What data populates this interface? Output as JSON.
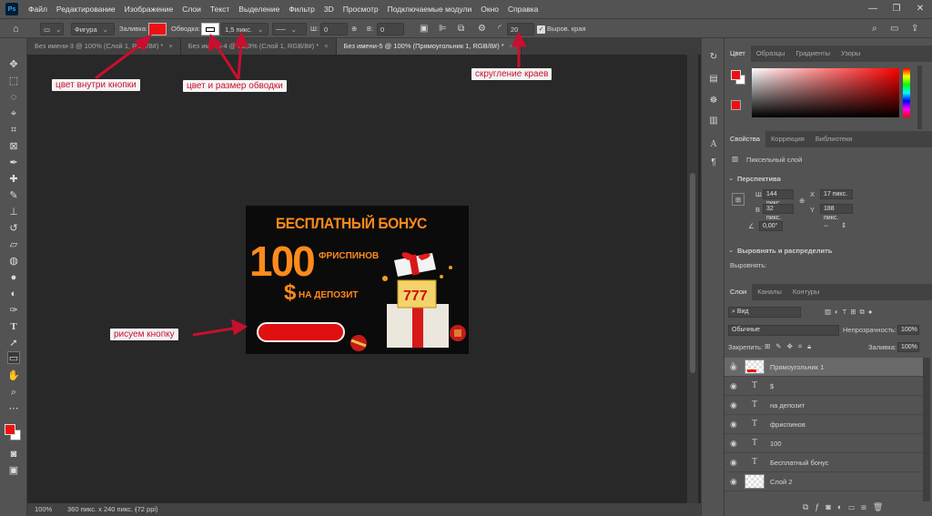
{
  "menu": {
    "logo": "Ps",
    "items": [
      "Файл",
      "Редактирование",
      "Изображение",
      "Слои",
      "Текст",
      "Выделение",
      "Фильтр",
      "3D",
      "Просмотр",
      "Подключаемые модули",
      "Окно",
      "Справка"
    ],
    "win_min": "—",
    "win_max": "❐",
    "win_close": "✕"
  },
  "options": {
    "mode": "Фигура",
    "fill_label": "Заливка:",
    "stroke_label": "Обводка:",
    "stroke_size": "1,5 пикс.",
    "w_label": "Ш:",
    "w_value": "0 пикс.",
    "h_label": "В:",
    "h_value": "0 пикс.",
    "radius": "20 пикс.",
    "align_edges": "Выров. края",
    "fill_color": "#ee1111"
  },
  "tabs": [
    {
      "label": "Без имени-3 @ 100% (Слой 1, RGB/8#) *"
    },
    {
      "label": "Без имени-4 @ 33,3% (Слой 1, RGB/8#) *"
    },
    {
      "label": "Без имени-5 @ 100% (Прямоугольник 1, RGB/8#) *"
    }
  ],
  "tab_close": "×",
  "banner": {
    "title": "БЕСПЛАТНЫЙ БОНУС",
    "number": "100",
    "spins": "ФРИСПИНОВ",
    "dollar": "$",
    "deposit": "НА ДЕПОЗИТ"
  },
  "annotations": {
    "fill": "цвет внутри кнопки",
    "stroke": "цвет и размер обводки",
    "radius": "скругление краев",
    "draw": "рисуем кнопку"
  },
  "status": {
    "zoom": "100%",
    "info": "360 пикс. x 240 пикс. (72 ppi)"
  },
  "color_panel": {
    "tabs": [
      "Цвет",
      "Образцы",
      "Градиенты",
      "Узоры"
    ],
    "fg": "#ee1111"
  },
  "props_panel": {
    "tabs": [
      "Свойства",
      "Коррекция",
      "Библиотеки"
    ],
    "layer_type": "Пиксельный слой",
    "section": "Перспектива",
    "w_label": "Ш",
    "w": "144 пикс.",
    "x_label": "X",
    "x": "17 пикс.",
    "h_label": "В",
    "h": "32 пикс.",
    "y_label": "Y",
    "y": "188 пикс.",
    "angle": "0,00°",
    "align_section": "Выровнять и распределить",
    "align_label": "Выровнять:"
  },
  "layers_panel": {
    "tabs": [
      "Слои",
      "Каналы",
      "Контуры"
    ],
    "filter": "Вид",
    "blend": "Обычные",
    "opacity_label": "Непрозрачность:",
    "opacity": "100%",
    "lock_label": "Закрепить:",
    "fill_label": "Заливка:",
    "fill": "100%",
    "layers": [
      {
        "name": "Прямоугольник 1",
        "kind": "shape",
        "selected": true
      },
      {
        "name": "$",
        "kind": "text"
      },
      {
        "name": "на депозит",
        "kind": "text"
      },
      {
        "name": "фриспинов",
        "kind": "text"
      },
      {
        "name": "100",
        "kind": "text"
      },
      {
        "name": "Бесплатный бонус",
        "kind": "text"
      },
      {
        "name": "Слой 2",
        "kind": "pixel"
      }
    ],
    "text_glyph": "T"
  }
}
